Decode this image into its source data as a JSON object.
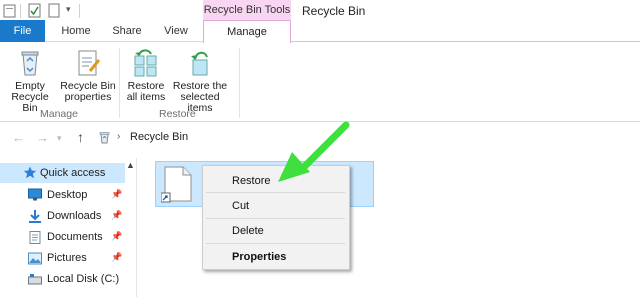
{
  "window": {
    "title": "Recycle Bin"
  },
  "contextual_tab_group": {
    "label": "Recycle Bin Tools"
  },
  "tabs": {
    "file": "File",
    "home": "Home",
    "share": "Share",
    "view": "View",
    "manage": "Manage"
  },
  "ribbon": {
    "empty_bin": "Empty\nRecycle Bin",
    "bin_properties": "Recycle Bin\nproperties",
    "restore_all": "Restore\nall items",
    "restore_selected": "Restore the\nselected items",
    "group_manage": "Manage",
    "group_restore": "Restore"
  },
  "address": {
    "location": "Recycle Bin"
  },
  "nav": {
    "items": [
      {
        "label": "Quick access",
        "icon": "star-icon"
      },
      {
        "label": "Desktop",
        "icon": "desktop-icon"
      },
      {
        "label": "Downloads",
        "icon": "downloads-icon"
      },
      {
        "label": "Documents",
        "icon": "documents-icon"
      },
      {
        "label": "Pictures",
        "icon": "pictures-icon"
      },
      {
        "label": "Local Disk (C:)",
        "icon": "drive-icon"
      }
    ]
  },
  "context_menu": {
    "restore": "Restore",
    "cut": "Cut",
    "delete": "Delete",
    "properties": "Properties"
  },
  "colors": {
    "file_tab": "#1979ca",
    "contextual": "#f8d5f0",
    "selection": "#cce8ff",
    "arrow": "#3de03d"
  }
}
